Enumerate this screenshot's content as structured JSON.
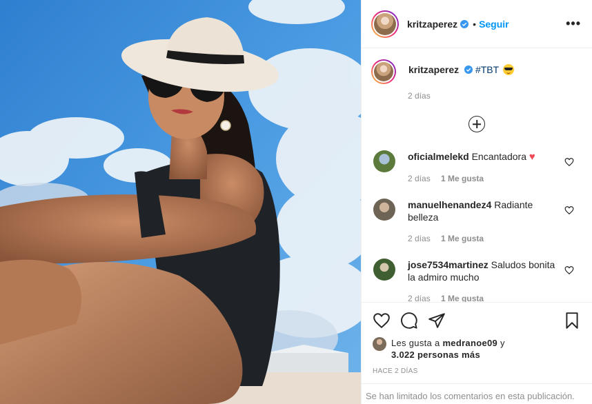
{
  "post": {
    "photo_alt": "",
    "sky_color": "#3d8fd8"
  },
  "header": {
    "username": "kritzaperez",
    "separator": "•",
    "follow_label": "Seguir",
    "more_label": "•••"
  },
  "caption": {
    "username": "kritzaperez",
    "text": "#TBT",
    "emoji": "sunglasses-emoji",
    "time": "2 días"
  },
  "comments": [
    {
      "username": "oficialmelekd",
      "text": "Encantadora",
      "emoji": "♥",
      "time": "2 días",
      "likes": "1 Me gusta",
      "avatar_color": "#6c8a4a"
    },
    {
      "username": "manuelhenandez4",
      "text": "Radiante belleza",
      "time": "2 días",
      "likes": "1 Me gusta",
      "avatar_color": "#7a6a55"
    },
    {
      "username": "jose7534martinez",
      "text": "Saludos bonita la admiro mucho",
      "time": "2 días",
      "likes": "1 Me gusta",
      "avatar_color": "#4c6a3a"
    }
  ],
  "actions": {
    "likes_prefix": "Les gusta a",
    "likes_user": "medranoe09",
    "likes_and": "y",
    "likes_count": "3.022 personas más",
    "time_ago": "HACE 2 DÍAS",
    "limited_notice": "Se han limitado los comentarios en esta publicación."
  },
  "colors": {
    "accent": "#0095f6",
    "like_red": "#ed4956",
    "muted": "#8e8e8e"
  }
}
